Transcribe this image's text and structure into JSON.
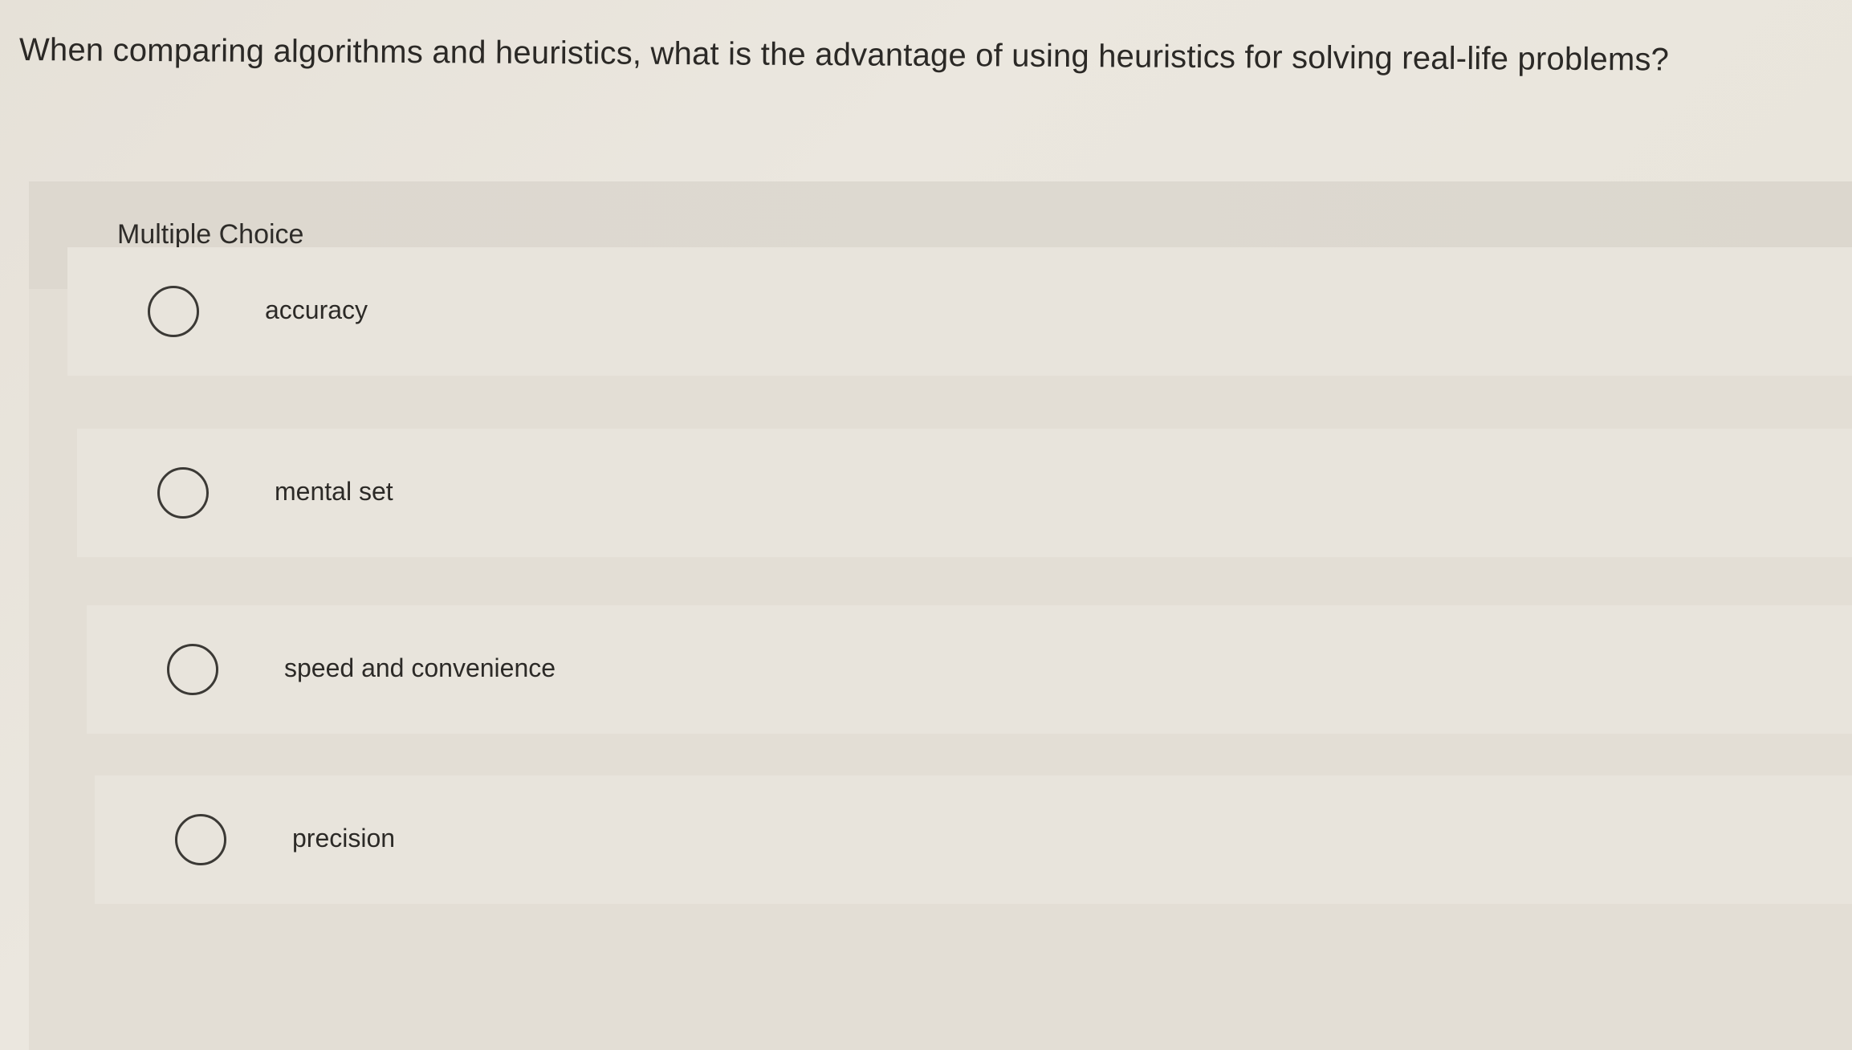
{
  "question": {
    "text": "When comparing algorithms and heuristics, what is the advantage of using heuristics for solving real-life problems?"
  },
  "panel": {
    "title": "Multiple Choice"
  },
  "options": [
    {
      "label": "accuracy",
      "selected": false
    },
    {
      "label": "mental set",
      "selected": false
    },
    {
      "label": "speed and convenience",
      "selected": false
    },
    {
      "label": "precision",
      "selected": false
    }
  ]
}
